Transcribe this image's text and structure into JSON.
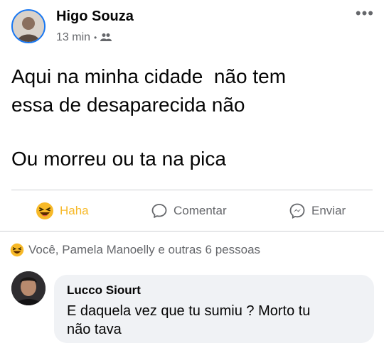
{
  "post": {
    "author": "Higo Souza",
    "time": "13 min",
    "dot": "•",
    "audience_icon": "friends-icon",
    "more_icon": "more-options-icon",
    "more_label": "•••",
    "text_lines": [
      "Aqui na minha cidade  não tem",
      "essa de desaparecida não"
    ],
    "text_line2": [
      "Ou morreu ou ta na pica"
    ]
  },
  "actions": {
    "haha_label": "Haha",
    "comment_label": "Comentar",
    "send_label": "Enviar",
    "haha_color": "#f7b928"
  },
  "reactions": {
    "summary": "Você, Pamela Manoelly e outras 6 pessoas"
  },
  "comment": {
    "author": "Lucco Siourt",
    "text_lines": [
      "E daquela vez que tu sumiu ? Morto tu",
      "não tava"
    ]
  },
  "colors": {
    "accent": "#1877f2",
    "muted": "#65676b",
    "bubble": "#f0f2f5"
  }
}
